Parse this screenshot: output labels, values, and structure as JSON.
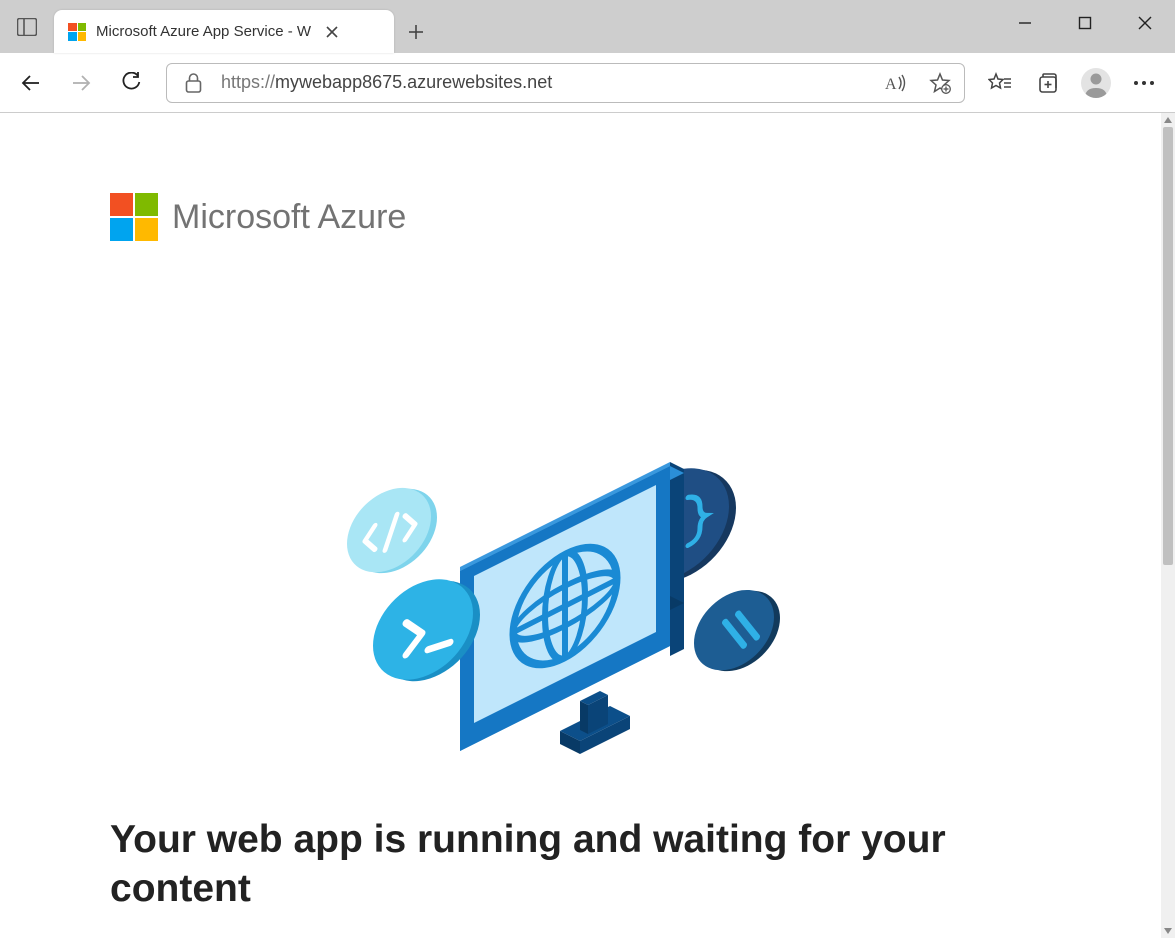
{
  "browser": {
    "tab_title": "Microsoft Azure App Service - W",
    "url_protocol": "https://",
    "url_host": "mywebapp8675.azurewebsites.net"
  },
  "page": {
    "brand": "Microsoft Azure",
    "headline": "Your web app is running and waiting for your content"
  }
}
